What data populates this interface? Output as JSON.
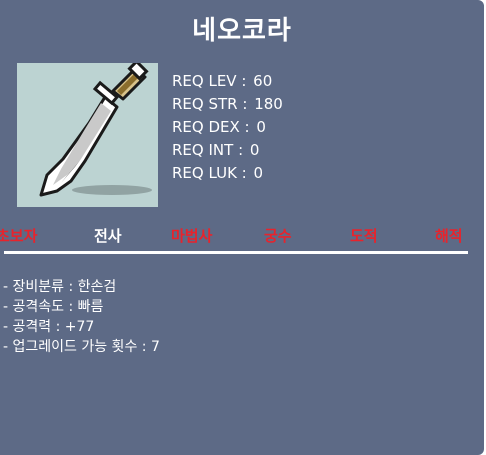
{
  "item": {
    "name": "네오코라",
    "icon": "dagger-icon"
  },
  "requirements": [
    {
      "label": "REQ LEV",
      "value": "60"
    },
    {
      "label": "REQ STR",
      "value": "180"
    },
    {
      "label": "REQ DEX",
      "value": "0"
    },
    {
      "label": "REQ INT",
      "value": "0"
    },
    {
      "label": "REQ LUK",
      "value": "0"
    }
  ],
  "jobs": [
    {
      "label": "초보자",
      "color": "#e8232c"
    },
    {
      "label": "전사",
      "color": "#ffffff"
    },
    {
      "label": "마법사",
      "color": "#e8232c"
    },
    {
      "label": "궁수",
      "color": "#e8232c"
    },
    {
      "label": "도적",
      "color": "#e8232c"
    },
    {
      "label": "해적",
      "color": "#e8232c"
    }
  ],
  "stats": [
    "- 장비분류 : 한손검",
    "- 공격속도 : 빠름",
    "- 공격력 : +77",
    "- 업그레이드 가능 횟수 : 7"
  ],
  "colors": {
    "panel": "#5d6a86",
    "icon_background": "#bcd3d2",
    "text": "#ffffff",
    "unavailable_job": "#e8232c"
  }
}
